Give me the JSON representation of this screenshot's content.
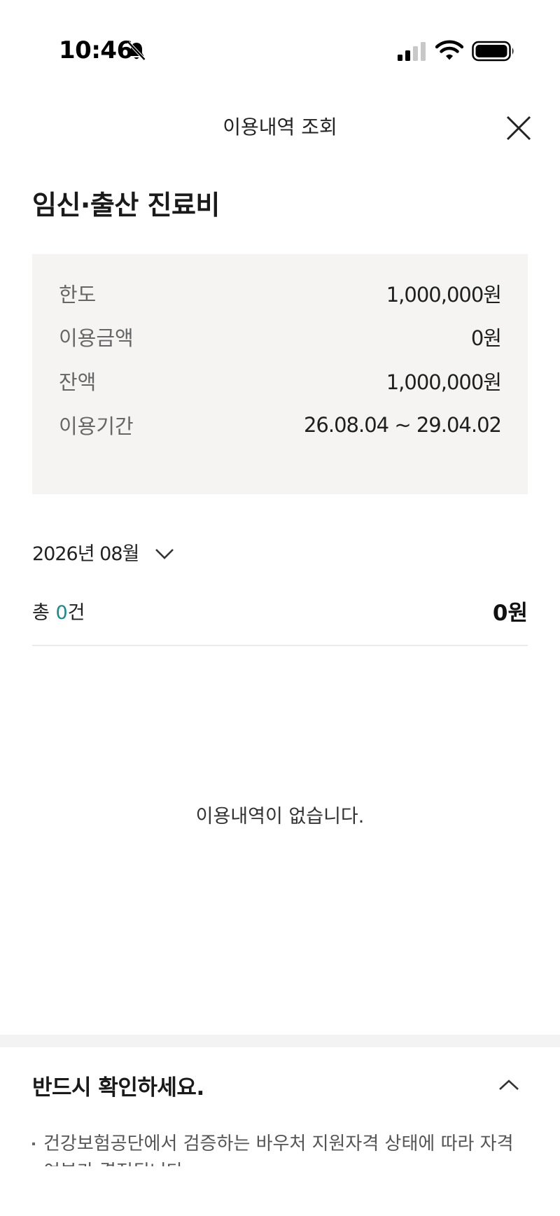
{
  "status_bar": {
    "time": "10:46",
    "icons": [
      "bell-slash-icon",
      "signal-icon",
      "wifi-icon",
      "battery-icon"
    ]
  },
  "header": {
    "title": "이용내역 조회",
    "close_icon": "close-icon"
  },
  "page_title": "임신·출산 진료비",
  "summary": {
    "rows": [
      {
        "label": "한도",
        "value": "1,000,000원"
      },
      {
        "label": "이용금액",
        "value": "0원"
      },
      {
        "label": "잔액",
        "value": "1,000,000원"
      },
      {
        "label": "이용기간",
        "value": "26.08.04 ~ 29.04.02"
      }
    ]
  },
  "month_selector": {
    "label": "2026년 08월",
    "icon": "chevron-down-icon"
  },
  "count": {
    "prefix": "총 ",
    "number": "0",
    "suffix": "건",
    "total": "0원"
  },
  "empty_message": "이용내역이 없습니다.",
  "notice": {
    "title": "반드시 확인하세요.",
    "icon": "chevron-up-icon",
    "items": [
      "건강보험공단에서 검증하는 바우처 지원자격 상태에 따라 자격 여부가 결정됩니다."
    ]
  },
  "colors": {
    "accent": "#1d8a8a",
    "summary_bg": "#f5f4f2",
    "divider": "#ebebeb"
  }
}
